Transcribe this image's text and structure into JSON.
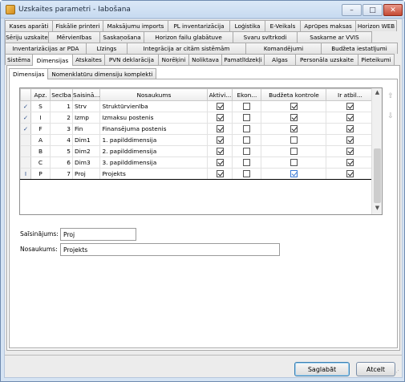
{
  "window": {
    "title": "Uzskaites parametri - Iabošana",
    "min_label": "–",
    "max_label": "□",
    "close_label": "✕"
  },
  "tabs": {
    "row1": [
      "Kases aparāti",
      "Fiskālie printeri",
      "Maksājumu imports",
      "PL inventarizācija",
      "Loģistika",
      "E-Veikals",
      "Aprūpes maksas",
      "Horizon WEB"
    ],
    "row2": [
      "Sēriju uzskaite",
      "Mērvienības",
      "Saskaņošana",
      "Horizon failu glabātuve",
      "Svaru svītrkodi",
      "Saskarne ar VVIS"
    ],
    "row3": [
      "Inventarizācijas ar PDA",
      "Līzings",
      "Integrācija ar citām sistēmām",
      "Komandējumi",
      "Budžeta iestatījumi"
    ],
    "row4": [
      "Sistēma",
      "Dimensijas",
      "Atskaites",
      "PVN deklarācija",
      "Norēķini",
      "Noliktava",
      "Pamatlīdzekļi",
      "Algas",
      "Personāla uzskaite",
      "Pieteikumi"
    ],
    "active": "Dimensijas"
  },
  "subtabs": [
    "Dimensijas",
    "Nomenklatūru dimensiju komplekti"
  ],
  "grid": {
    "columns": [
      "",
      "Apz.",
      "Secība",
      "Saisinā...",
      "Nosaukums",
      "Aktivi...",
      "Ekon...",
      "Budžeta kontrole",
      "Ir atbil..."
    ],
    "rows": [
      {
        "marker": "✓",
        "apz": "S",
        "seciba": "1",
        "saisinajums": "Strv",
        "nosaukums": "Struktūrvienība",
        "aktivs": true,
        "ekon": false,
        "budzeta": true,
        "atbil": true
      },
      {
        "marker": "✓",
        "apz": "I",
        "seciba": "2",
        "saisinajums": "Izmp",
        "nosaukums": "Izmaksu postenis",
        "aktivs": true,
        "ekon": false,
        "budzeta": true,
        "atbil": true
      },
      {
        "marker": "✓",
        "apz": "F",
        "seciba": "3",
        "saisinajums": "Fin",
        "nosaukums": "Finansējuma postenis",
        "aktivs": true,
        "ekon": false,
        "budzeta": true,
        "atbil": true
      },
      {
        "marker": "",
        "apz": "A",
        "seciba": "4",
        "saisinajums": "Dim1",
        "nosaukums": "1. papilddimensija",
        "aktivs": true,
        "ekon": false,
        "budzeta": false,
        "atbil": true
      },
      {
        "marker": "",
        "apz": "B",
        "seciba": "5",
        "saisinajums": "Dim2",
        "nosaukums": "2. papilddimensija",
        "aktivs": true,
        "ekon": false,
        "budzeta": false,
        "atbil": true
      },
      {
        "marker": "",
        "apz": "C",
        "seciba": "6",
        "saisinajums": "Dim3",
        "nosaukums": "3. papilddimensija",
        "aktivs": true,
        "ekon": false,
        "budzeta": false,
        "atbil": true
      },
      {
        "marker": "I",
        "apz": "P",
        "seciba": "7",
        "saisinajums": "Proj",
        "nosaukums": "Projekts",
        "aktivs": true,
        "ekon": false,
        "budzeta": true,
        "atbil": true
      }
    ],
    "selected_row": 6
  },
  "form": {
    "saisinajums_label": "Saīsinājums:",
    "saisinajums_value": "Proj",
    "nosaukums_label": "Nosaukums:",
    "nosaukums_value": "Projekts"
  },
  "buttons": {
    "save": "Saglabāt",
    "cancel": "Atcelt"
  },
  "side_arrows": {
    "up": "⇧",
    "down": "⇩"
  },
  "scroll": {
    "up": "▲",
    "down": "▼"
  }
}
